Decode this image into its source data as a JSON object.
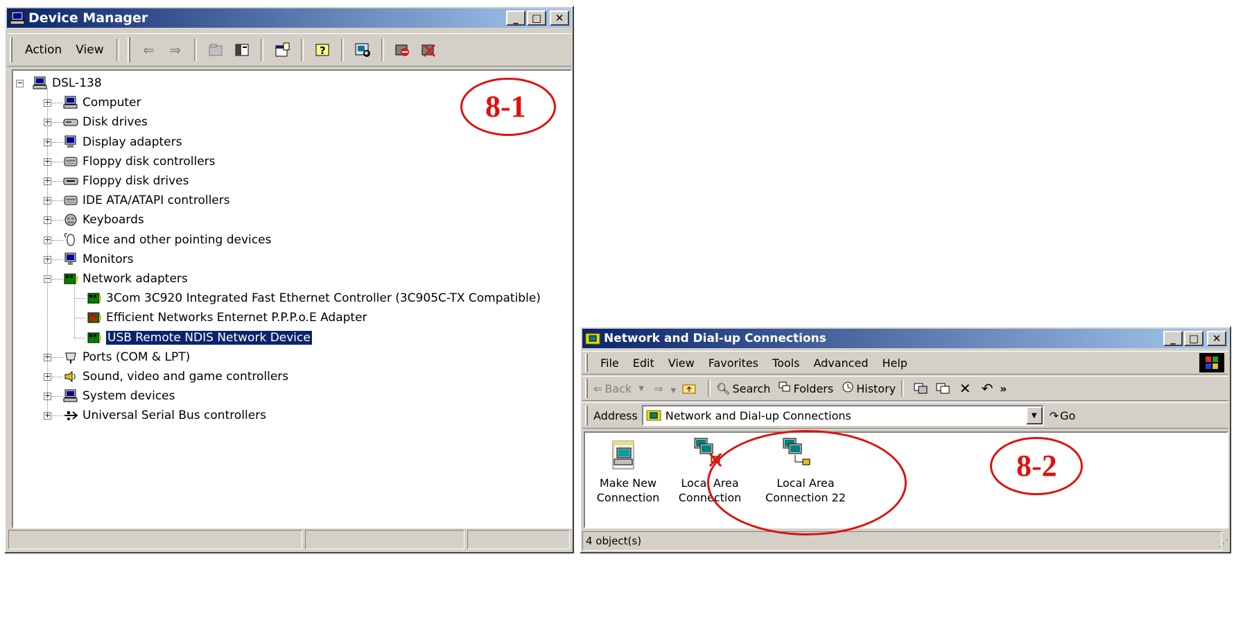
{
  "device_manager": {
    "title": "Device Manager",
    "menu": {
      "action": "Action",
      "view": "View"
    },
    "root": "DSL-138",
    "categories": [
      {
        "label": "Computer",
        "icon": "computer-icon"
      },
      {
        "label": "Disk drives",
        "icon": "disk-drive-icon"
      },
      {
        "label": "Display adapters",
        "icon": "display-adapter-icon"
      },
      {
        "label": "Floppy disk controllers",
        "icon": "floppy-controller-icon"
      },
      {
        "label": "Floppy disk drives",
        "icon": "floppy-drive-icon"
      },
      {
        "label": "IDE ATA/ATAPI controllers",
        "icon": "ide-controller-icon"
      },
      {
        "label": "Keyboards",
        "icon": "keyboard-icon"
      },
      {
        "label": "Mice and other pointing devices",
        "icon": "mouse-icon"
      },
      {
        "label": "Monitors",
        "icon": "monitor-icon"
      },
      {
        "label": "Network adapters",
        "icon": "network-adapter-icon"
      },
      {
        "label": "Ports (COM & LPT)",
        "icon": "port-icon"
      },
      {
        "label": "Sound, video and game controllers",
        "icon": "sound-icon"
      },
      {
        "label": "System devices",
        "icon": "system-device-icon"
      },
      {
        "label": "Universal Serial Bus controllers",
        "icon": "usb-icon"
      }
    ],
    "network_children": [
      "3Com 3C920 Integrated Fast Ethernet Controller (3C905C-TX Compatible)",
      "Efficient Networks Enternet P.P.P.o.E Adapter",
      "USB Remote NDIS Network Device"
    ],
    "annotation": "8-1"
  },
  "network_connections": {
    "title": "Network and Dial-up Connections",
    "menu": {
      "file": "File",
      "edit": "Edit",
      "view": "View",
      "favorites": "Favorites",
      "tools": "Tools",
      "advanced": "Advanced",
      "help": "Help"
    },
    "toolbar": {
      "back": "Back",
      "search": "Search",
      "folders": "Folders",
      "history": "History",
      "more": "»"
    },
    "address": {
      "label": "Address",
      "value": "Network and Dial-up Connections",
      "go": "Go"
    },
    "items": [
      {
        "line1": "Make New",
        "line2": "Connection"
      },
      {
        "line1": "Local Area",
        "line2": "Connection"
      },
      {
        "line1": "Local Area",
        "line2": "Connection 22"
      }
    ],
    "status": "4 object(s)",
    "annotation": "8-2"
  },
  "colors": {
    "annotation": "#e01010",
    "titlebar": "#0a246a",
    "selection": "#0a246a"
  }
}
